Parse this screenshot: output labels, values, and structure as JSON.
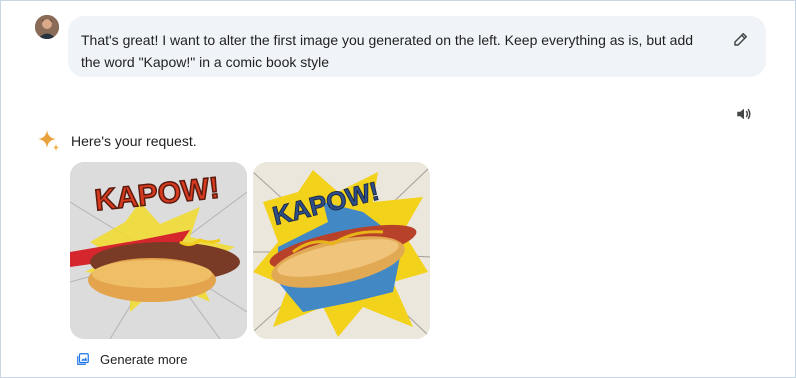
{
  "conversation": {
    "user_message": "That's great! I want to alter the first image you generated on the left. Keep everything as is, but add the word \"Kapow!\" in a comic book style",
    "response_text": "Here's your request.",
    "images": [
      {
        "caption_text": "KAPOW!"
      },
      {
        "caption_text": "KAPOW!"
      }
    ],
    "generate_more_label": "Generate more"
  },
  "icons": {
    "edit": "pencil-icon",
    "speaker": "speaker-icon",
    "assistant": "sparkle-icon",
    "generate_more": "image-stack-icon"
  },
  "colors": {
    "bubble_bg": "#f0f4f9",
    "sparkle": "#e8a23c",
    "link_icon": "#1a73e8",
    "kapow_red": "#d83a1f",
    "kapow_yellow": "#f3d21b",
    "comic_blue": "#2f7fd8"
  }
}
